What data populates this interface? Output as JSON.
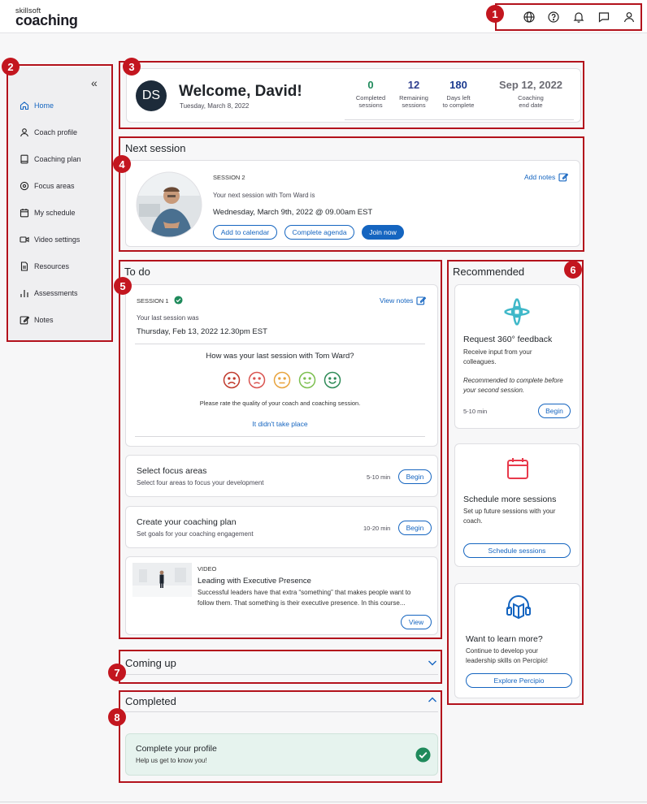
{
  "app": {
    "logo_small": "skillsoft",
    "logo_big": "coaching"
  },
  "topbar_icons": [
    "globe-icon",
    "help-icon",
    "bell-icon",
    "chat-icon",
    "user-icon"
  ],
  "sidebar": {
    "collapse_label": "«",
    "items": [
      {
        "label": "Home",
        "icon": "home-icon",
        "active": true
      },
      {
        "label": "Coach profile",
        "icon": "person-icon"
      },
      {
        "label": "Coaching plan",
        "icon": "book-icon"
      },
      {
        "label": "Focus areas",
        "icon": "target-icon"
      },
      {
        "label": "My schedule",
        "icon": "calendar-icon"
      },
      {
        "label": "Video settings",
        "icon": "video-icon"
      },
      {
        "label": "Resources",
        "icon": "document-icon"
      },
      {
        "label": "Assessments",
        "icon": "bars-icon"
      },
      {
        "label": "Notes",
        "icon": "edit-icon"
      }
    ]
  },
  "welcome": {
    "initials": "DS",
    "title": "Welcome, David!",
    "date": "Tuesday, March 8, 2022",
    "stats": [
      {
        "value": "0",
        "label1": "Completed",
        "label2": "sessions",
        "color": "#1f8a5b"
      },
      {
        "value": "12",
        "label1": "Remaining",
        "label2": "sessions",
        "color": "#2f3f8f"
      },
      {
        "value": "180",
        "label1": "Days left",
        "label2": "to complete",
        "color": "#1b3a8f"
      },
      {
        "value": "Sep 12, 2022",
        "label1": "Coaching",
        "label2": "end date",
        "color": "#6b6b73"
      }
    ]
  },
  "next_session": {
    "section_title": "Next session",
    "session_label": "SESSION 2",
    "line1": "Your next session with Tom Ward is",
    "when": "Wednesday, March 9th, 2022 @ 09.00am EST",
    "add_notes": "Add notes",
    "btn_calendar": "Add to calendar",
    "btn_agenda": "Complete agenda",
    "btn_join": "Join now"
  },
  "todo": {
    "section_title": "To do",
    "session_label": "SESSION 1",
    "view_notes": "View notes",
    "last_was": "Your last session was",
    "last_when": "Thursday, Feb 13, 2022 12.30pm EST",
    "question": "How was your last session with Tom Ward?",
    "rate_text": "Please rate the quality of your coach and coaching session.",
    "didnt_happen": "It didn't take place",
    "faces": [
      {
        "name": "very-unhappy-face-icon",
        "color": "#c0392b"
      },
      {
        "name": "unhappy-face-icon",
        "color": "#d9534f"
      },
      {
        "name": "neutral-face-icon",
        "color": "#e8a33d"
      },
      {
        "name": "happy-face-icon",
        "color": "#7cbf4f"
      },
      {
        "name": "very-happy-face-icon",
        "color": "#2e8b57"
      }
    ],
    "tasks": [
      {
        "title": "Select focus areas",
        "desc": "Select four areas to focus your development",
        "time": "5-10 min",
        "btn": "Begin"
      },
      {
        "title": "Create your coaching plan",
        "desc": "Set goals for your coaching engagement",
        "time": "10-20 min",
        "btn": "Begin"
      }
    ],
    "video": {
      "kind": "VIDEO",
      "title": "Leading with Executive Presence",
      "desc1": "Successful leaders have that extra “something” that makes people want to",
      "desc2": "follow them. That something is their executive presence. In this course...",
      "btn": "View"
    }
  },
  "recommended": {
    "section_title": "Recommended",
    "cards": [
      {
        "icon": "feedback-360-icon",
        "title": "Request 360° feedback",
        "desc1": "Receive input from your",
        "desc2": "colleagues.",
        "note1": "Recommended to complete before",
        "note2": "your second session.",
        "time": "5-10 min",
        "btn": "Begin"
      },
      {
        "icon": "calendar-add-icon",
        "title": "Schedule more sessions",
        "desc1": "Set up future sessions with your",
        "desc2": "coach.",
        "btn": "Schedule sessions"
      },
      {
        "icon": "headphones-book-icon",
        "title": "Want to learn more?",
        "desc1": "Continue to develop your",
        "desc2": "leadership skills on Percipio!",
        "btn": "Explore Percipio"
      }
    ]
  },
  "coming_up": {
    "section_title": "Coming up"
  },
  "completed": {
    "section_title": "Completed",
    "item_title": "Complete your profile",
    "item_desc": "Help us get to know you!"
  },
  "annotations": [
    "1",
    "2",
    "3",
    "4",
    "5",
    "6",
    "7",
    "8"
  ],
  "colors": {
    "accent": "#1565c0",
    "annotation": "#b3121c",
    "success": "#1f8a5b"
  }
}
